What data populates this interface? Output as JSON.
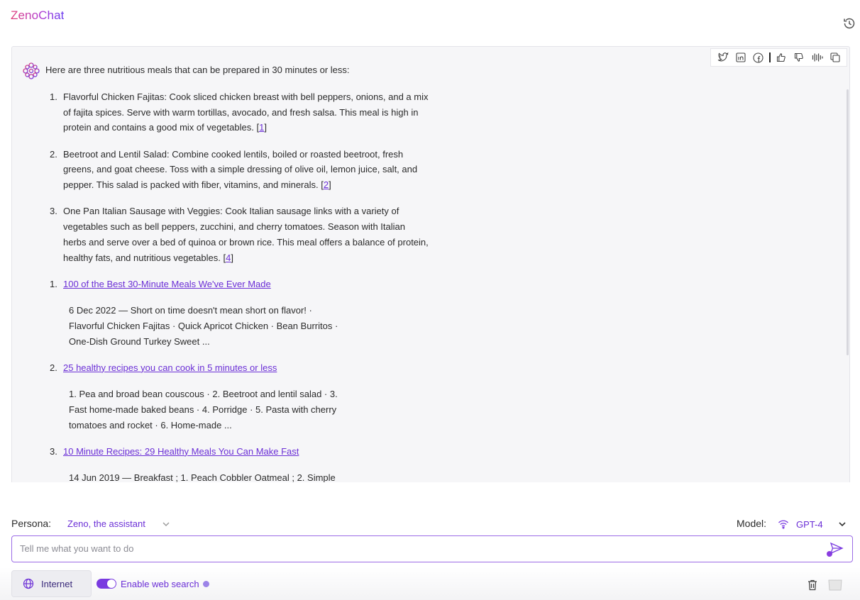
{
  "header": {
    "app_name": "ZenoChat",
    "history_icon": "history-icon"
  },
  "message": {
    "intro": "Here are three nutritious meals that can be prepared in 30 minutes or less:",
    "toolbar": [
      "twitter-icon",
      "linkedin-icon",
      "facebook-icon",
      "thumbs-up-icon",
      "thumbs-down-icon",
      "audio-wave-icon",
      "copy-icon"
    ],
    "meals": [
      {
        "num": "1.",
        "text": "Flavorful Chicken Fajitas: Cook sliced chicken breast with bell peppers, onions, and a mix of fajita spices. Serve with warm tortillas, avocado, and fresh salsa. This meal is high in protein and contains a good mix of vegetables. ",
        "cite": "1"
      },
      {
        "num": "2.",
        "text": "Beetroot and Lentil Salad: Combine cooked lentils, boiled or roasted beetroot, fresh greens, and goat cheese. Toss with a simple dressing of olive oil, lemon juice, salt, and pepper. This salad is packed with fiber, vitamins, and minerals. ",
        "cite": "2"
      },
      {
        "num": "3.",
        "text": "One Pan Italian Sausage with Veggies: Cook Italian sausage links with a variety of vegetables such as bell peppers, zucchini, and cherry tomatoes. Season with Italian herbs and serve over a bed of quinoa or brown rice. This meal offers a balance of protein, healthy fats, and nutritious vegetables. ",
        "cite": "4"
      }
    ],
    "sources": [
      {
        "num": "1.",
        "title": "100 of the Best 30-Minute Meals We've Ever Made",
        "snippet": "6 Dec 2022 — Short on time doesn't mean short on flavor! · Flavorful Chicken Fajitas · Quick Apricot Chicken · Bean Burritos · One-Dish Ground Turkey Sweet ..."
      },
      {
        "num": "2.",
        "title": "25 healthy recipes you can cook in 5 minutes or less",
        "snippet": "1. Pea and broad bean couscous · 2. Beetroot and lentil salad · 3. Fast home-made baked beans · 4. Porridge · 5. Pasta with cherry tomatoes and rocket · 6. Home-made ..."
      },
      {
        "num": "3.",
        "title": "10 Minute Recipes: 29 Healthy Meals You Can Make Fast",
        "snippet": "14 Jun 2019 — Breakfast ; 1. Peach Cobbler Oatmeal ; 2. Simple"
      }
    ]
  },
  "controls": {
    "persona_label": "Persona:",
    "persona_value": "Zeno, the assistant",
    "model_label": "Model:",
    "model_value": "GPT-4",
    "input_placeholder": "Tell me what you want to do",
    "internet_label": "Internet",
    "web_search_label": "Enable web search",
    "web_search_enabled": true
  },
  "colors": {
    "accent": "#6b2fd6",
    "toggle": "#7a3be0",
    "panel": "#f6f6f8"
  }
}
